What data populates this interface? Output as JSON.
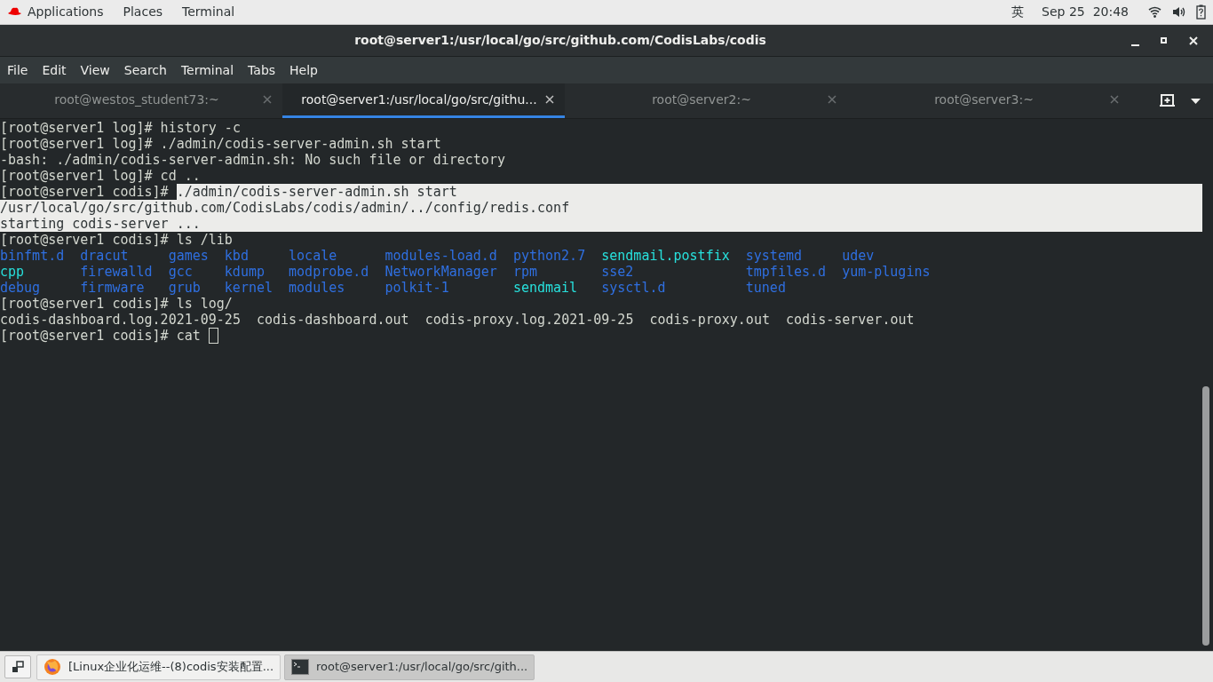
{
  "top_bar": {
    "menus": [
      "Applications",
      "Places",
      "Terminal"
    ],
    "input_method": "英",
    "clock": "Sep 25  20:48"
  },
  "window": {
    "title": "root@server1:/usr/local/go/src/github.com/CodisLabs/codis"
  },
  "menu_bar": [
    "File",
    "Edit",
    "View",
    "Search",
    "Terminal",
    "Tabs",
    "Help"
  ],
  "tabs": [
    {
      "label": "root@westos_student73:~",
      "selected": false
    },
    {
      "label": "root@server1:/usr/local/go/src/githu...",
      "selected": true
    },
    {
      "label": "root@server2:~",
      "selected": false
    },
    {
      "label": "root@server3:~",
      "selected": false
    }
  ],
  "terminal": {
    "lines": [
      {
        "kind": "text",
        "selected": false,
        "segments": [
          {
            "text": "[root@server1 log]# history -c",
            "selected": false
          }
        ]
      },
      {
        "kind": "text",
        "selected": false,
        "segments": [
          {
            "text": "[root@server1 log]# ./admin/codis-server-admin.sh start",
            "selected": false
          }
        ]
      },
      {
        "kind": "text",
        "selected": false,
        "segments": [
          {
            "text": "-bash: ./admin/codis-server-admin.sh: No such file or directory",
            "selected": false
          }
        ]
      },
      {
        "kind": "text",
        "selected": false,
        "segments": [
          {
            "text": "[root@server1 log]# cd ..",
            "selected": false
          }
        ]
      },
      {
        "kind": "text",
        "selected": true,
        "segments": [
          {
            "text": "[root@server1 codis]# ",
            "selected": false
          },
          {
            "text": "./admin/codis-server-admin.sh start",
            "selected": true
          }
        ]
      },
      {
        "kind": "text",
        "selected": true,
        "segments": [
          {
            "text": "/usr/local/go/src/github.com/CodisLabs/codis/admin/../config/redis.conf",
            "selected": true
          }
        ]
      },
      {
        "kind": "text",
        "selected": true,
        "segments": [
          {
            "text": "starting codis-server ...",
            "selected": true
          }
        ]
      },
      {
        "kind": "text",
        "selected": false,
        "segments": [
          {
            "text": "[root@server1 codis]# ls /lib",
            "selected": false
          }
        ]
      },
      {
        "kind": "listing",
        "cells": [
          {
            "name": "binfmt.d",
            "kind": "dir"
          },
          {
            "name": "dracut",
            "kind": "dir"
          },
          {
            "name": "games",
            "kind": "dir"
          },
          {
            "name": "kbd",
            "kind": "dir"
          },
          {
            "name": "locale",
            "kind": "dir"
          },
          {
            "name": "modules-load.d",
            "kind": "dir"
          },
          {
            "name": "python2.7",
            "kind": "dir"
          },
          {
            "name": "sendmail.postfix",
            "kind": "link"
          },
          {
            "name": "systemd",
            "kind": "dir"
          },
          {
            "name": "udev",
            "kind": "dir"
          }
        ]
      },
      {
        "kind": "listing",
        "cells": [
          {
            "name": "cpp",
            "kind": "link"
          },
          {
            "name": "firewalld",
            "kind": "dir"
          },
          {
            "name": "gcc",
            "kind": "dir"
          },
          {
            "name": "kdump",
            "kind": "dir"
          },
          {
            "name": "modprobe.d",
            "kind": "dir"
          },
          {
            "name": "NetworkManager",
            "kind": "dir"
          },
          {
            "name": "rpm",
            "kind": "dir"
          },
          {
            "name": "sse2",
            "kind": "dir"
          },
          {
            "name": "tmpfiles.d",
            "kind": "dir"
          },
          {
            "name": "yum-plugins",
            "kind": "dir"
          }
        ]
      },
      {
        "kind": "listing",
        "cells": [
          {
            "name": "debug",
            "kind": "dir"
          },
          {
            "name": "firmware",
            "kind": "dir"
          },
          {
            "name": "grub",
            "kind": "dir"
          },
          {
            "name": "kernel",
            "kind": "dir"
          },
          {
            "name": "modules",
            "kind": "dir"
          },
          {
            "name": "polkit-1",
            "kind": "dir"
          },
          {
            "name": "sendmail",
            "kind": "link"
          },
          {
            "name": "sysctl.d",
            "kind": "dir"
          },
          {
            "name": "tuned",
            "kind": "dir"
          }
        ]
      },
      {
        "kind": "text",
        "selected": false,
        "segments": [
          {
            "text": "[root@server1 codis]# ls log/",
            "selected": false
          }
        ]
      },
      {
        "kind": "text",
        "selected": false,
        "segments": [
          {
            "text": "codis-dashboard.log.2021-09-25  codis-dashboard.out  codis-proxy.log.2021-09-25  codis-proxy.out  codis-server.out",
            "selected": false
          }
        ]
      },
      {
        "kind": "text",
        "selected": false,
        "cursor": true,
        "segments": [
          {
            "text": "[root@server1 codis]# cat ",
            "selected": false
          }
        ]
      }
    ]
  },
  "taskbar": {
    "items": [
      {
        "label": "[Linux企业化运维--(8)codis安装配置...",
        "kind": "browser",
        "selected": false
      },
      {
        "label": "root@server1:/usr/local/go/src/gith...",
        "kind": "terminal",
        "selected": true
      }
    ]
  }
}
